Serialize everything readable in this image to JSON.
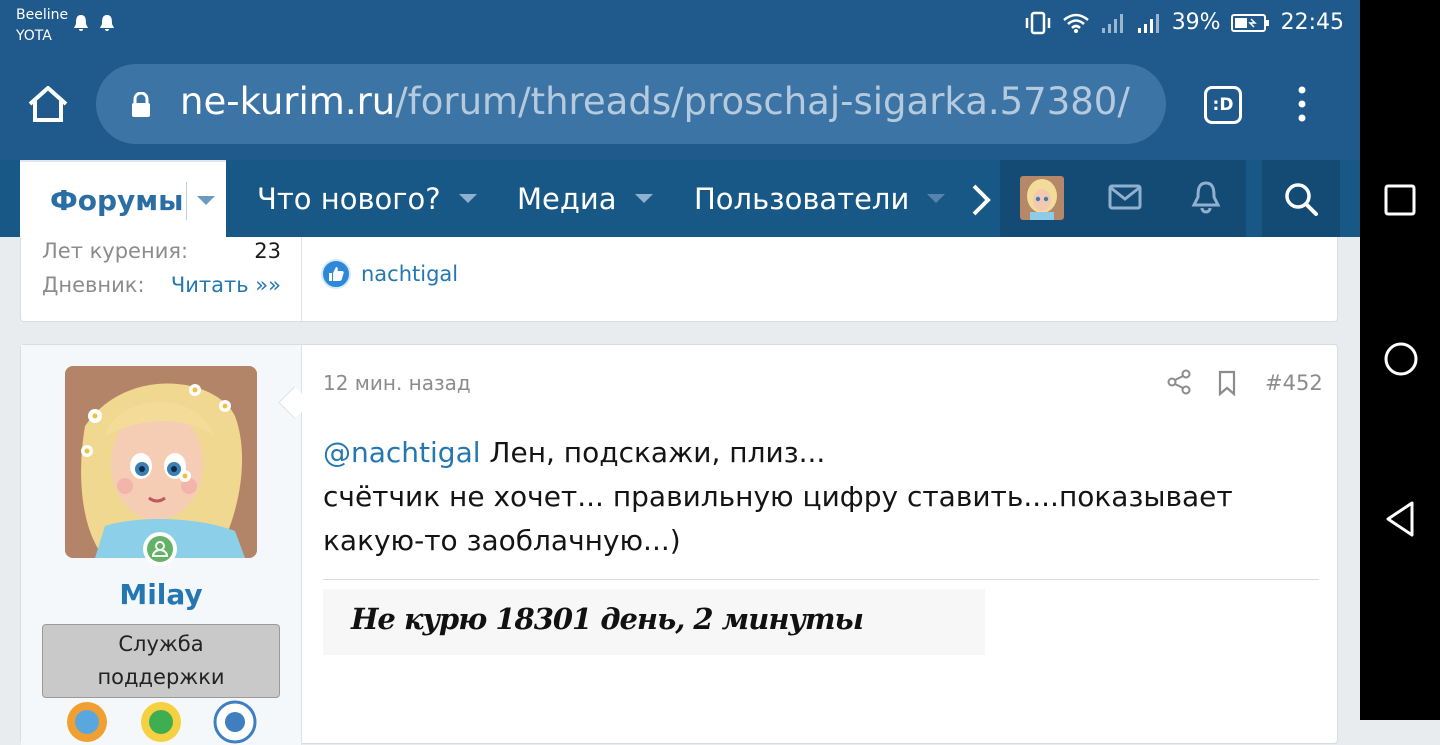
{
  "status_bar": {
    "carrier_1": "Beeline",
    "carrier_2": "YOTA",
    "battery": "39%",
    "time": "22:45"
  },
  "address_bar": {
    "url_host": "ne-kurim.ru",
    "url_path": "/forum/threads/proschaj-sigarka.57380/",
    "tab_button": ":D"
  },
  "nav": {
    "forums": "Форумы",
    "whats_new": "Что нового?",
    "media": "Медиа",
    "members": "Пользователи"
  },
  "prev_post": {
    "stats": [
      {
        "label": "Лет курения:",
        "value": "23"
      },
      {
        "label": "Дневник:",
        "link": "Читать »»"
      }
    ],
    "reaction_user": "nachtigal"
  },
  "post": {
    "time": "12 мин. назад",
    "number": "#452",
    "author": "Milay",
    "role_line1": "Служба",
    "role_line2": "поддержки",
    "mention": "@nachtigal",
    "line1": " Лен, подскажи, плиз...",
    "line2": "счётчик не хочет... правильную цифру ставить....показывает",
    "line3": "какую-то заоблачную...)",
    "signature": "Не курю 18301 день, 2 минуты"
  },
  "icons": [
    "home-icon",
    "lock-icon",
    "tab-switcher-icon",
    "menu-icon",
    "chevron-right-icon",
    "mail-icon",
    "bell-icon",
    "search-icon",
    "share-icon",
    "bookmark-icon",
    "like-icon",
    "online-status-icon",
    "square-icon",
    "circle-icon",
    "back-triangle-icon"
  ],
  "colors": {
    "header": "#205a8c",
    "nav": "#185886",
    "link": "#2577b1",
    "online": "#63b265"
  }
}
